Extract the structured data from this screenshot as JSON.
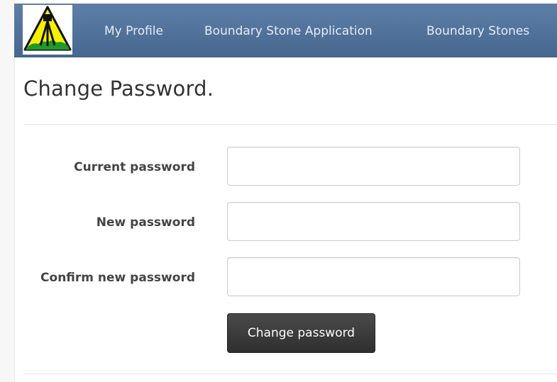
{
  "nav": {
    "logo_icon": "surveyor-tripod-logo-icon",
    "items": [
      {
        "label": "My Profile"
      },
      {
        "label": "Boundary Stone Application"
      },
      {
        "label": "Boundary Stones"
      }
    ]
  },
  "page": {
    "title": "Change Password."
  },
  "form": {
    "current_password": {
      "label": "Current password",
      "value": "",
      "placeholder": ""
    },
    "new_password": {
      "label": "New password",
      "value": "",
      "placeholder": ""
    },
    "confirm_password": {
      "label": "Confirm new password",
      "value": "",
      "placeholder": ""
    },
    "submit_label": "Change password"
  },
  "colors": {
    "navbar": "#46688f",
    "nav_text": "#e6ecf4",
    "logo_yellow": "#f4f000",
    "logo_green": "#1f9a2a",
    "button": "#333333",
    "button_text": "#ffffff"
  }
}
